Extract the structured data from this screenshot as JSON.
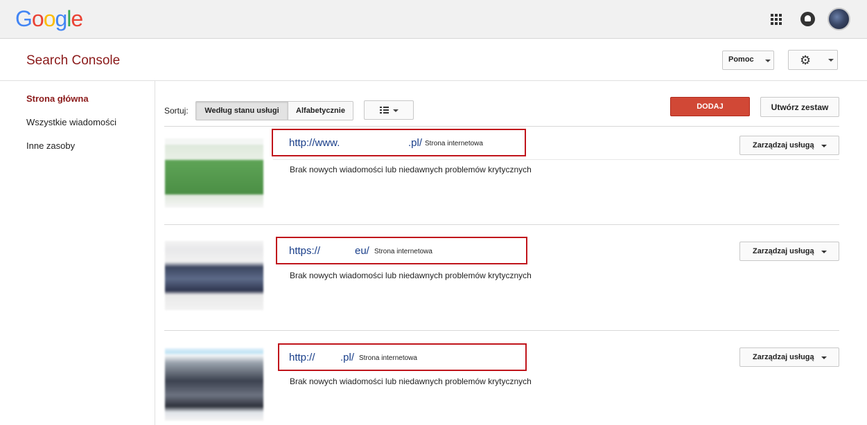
{
  "topbar": {
    "logo_letters": [
      "G",
      "o",
      "o",
      "g",
      "l",
      "e"
    ],
    "logo_colors": [
      "#4285F4",
      "#EA4335",
      "#FBBC05",
      "#4285F4",
      "#34A853",
      "#EA4335"
    ],
    "icons": [
      "apps-grid-icon",
      "notifications-icon",
      "account-avatar"
    ]
  },
  "header": {
    "title": "Search Console",
    "help_label": "Pomoc",
    "settings_icon": "gear-icon"
  },
  "sidebar": {
    "items": [
      {
        "label": "Strona główna",
        "active": true
      },
      {
        "label": "Wszystkie wiadomości",
        "active": false
      },
      {
        "label": "Inne zasoby",
        "active": false
      }
    ]
  },
  "toolbar": {
    "sort_label": "Sortuj:",
    "sort_options": [
      {
        "label": "Według stanu usługi",
        "selected": true
      },
      {
        "label": "Alfabetycznie",
        "selected": false
      }
    ],
    "view_icon": "list-view-icon",
    "add_label": "DODAJ",
    "create_set_label": "Utwórz zestaw",
    "accent_color": "#d14836"
  },
  "properties": [
    {
      "url_prefix": "http://www.",
      "url_suffix": ".pl/",
      "type": "Strona internetowa",
      "status": "Brak nowych wiadomości lub niedawnych problemów krytycznych",
      "manage_label": "Zarządzaj usługą"
    },
    {
      "url_prefix": "https://",
      "url_suffix": "eu/",
      "type": "Strona internetowa",
      "status": "Brak nowych wiadomości lub niedawnych problemów krytycznych",
      "manage_label": "Zarządzaj usługą"
    },
    {
      "url_prefix": "http://",
      "url_suffix": ".pl/",
      "type": "Strona internetowa",
      "status": "Brak nowych wiadomości lub niedawnych problemów krytycznych",
      "manage_label": "Zarządzaj usługą"
    }
  ]
}
